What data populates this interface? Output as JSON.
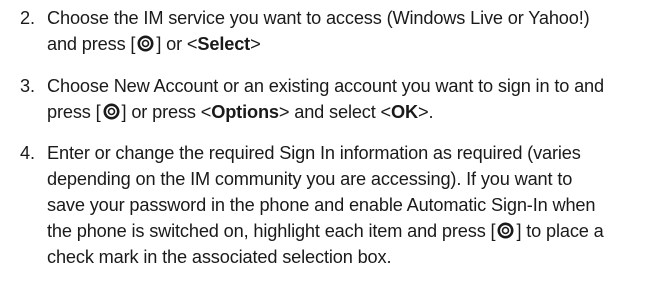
{
  "steps": [
    {
      "number": "2.",
      "lines": [
        {
          "parts": [
            {
              "t": "Choose the IM service you want to access (Windows Live or Yahoo!)"
            }
          ]
        },
        {
          "parts": [
            {
              "t": "and press ["
            },
            {
              "key": "nav-key-icon"
            },
            {
              "t": "] or <"
            },
            {
              "t": "Select",
              "b": true
            },
            {
              "t": ">"
            }
          ]
        }
      ]
    },
    {
      "number": "3.",
      "lines": [
        {
          "parts": [
            {
              "t": "Choose New Account or an existing account you want to sign in to and"
            }
          ]
        },
        {
          "parts": [
            {
              "t": "press ["
            },
            {
              "key": "nav-key-icon"
            },
            {
              "t": "] or press <"
            },
            {
              "t": "Options",
              "b": true
            },
            {
              "t": "> and select <"
            },
            {
              "t": "OK",
              "b": true
            },
            {
              "t": ">."
            }
          ]
        }
      ]
    },
    {
      "number": "4.",
      "lines": [
        {
          "parts": [
            {
              "t": "Enter or change the required Sign In information as required (varies"
            }
          ]
        },
        {
          "parts": [
            {
              "t": "depending on the IM community you are accessing). If you want to"
            }
          ]
        },
        {
          "parts": [
            {
              "t": "save your password in the phone and enable Automatic Sign-In when"
            }
          ]
        },
        {
          "parts": [
            {
              "t": "the phone is switched on, highlight each item and press ["
            },
            {
              "key": "nav-key-icon"
            },
            {
              "t": "] to place a"
            }
          ]
        },
        {
          "parts": [
            {
              "t": "check mark in the associated selection box."
            }
          ]
        }
      ]
    }
  ]
}
